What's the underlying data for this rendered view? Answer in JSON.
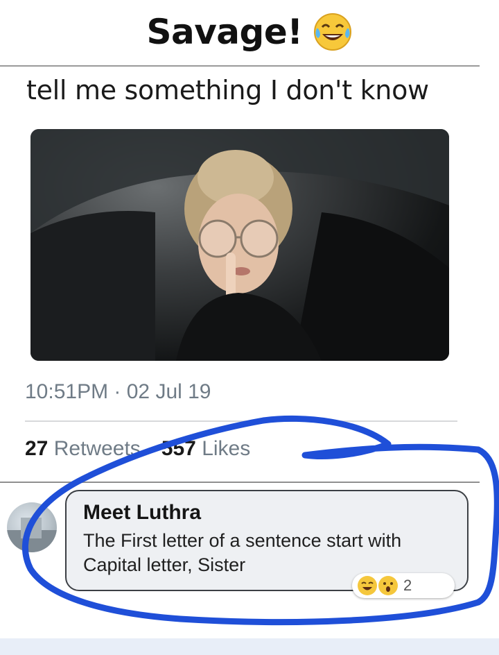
{
  "header": {
    "title": "Savage!",
    "emoji_icon": "tears-of-joy-icon"
  },
  "tweet": {
    "text": "tell me something I don't know",
    "photo_icon": "woman-shushing-photo",
    "timestamp": "10:51PM · 02 Jul 19",
    "retweets_count": "27",
    "retweets_label": "Retweets",
    "likes_count": "557",
    "likes_label": "Likes"
  },
  "comment": {
    "author": "Meet Luthra",
    "body": "The First letter of a sentence start with Capital letter, Sister",
    "reactions": [
      "laughing-reaction-icon",
      "wow-reaction-icon"
    ],
    "reaction_count": "2"
  },
  "colors": {
    "annotation_scribble": "#1f4fd8",
    "meta_text": "#6f7b86",
    "bubble_bg": "#eef0f3"
  }
}
